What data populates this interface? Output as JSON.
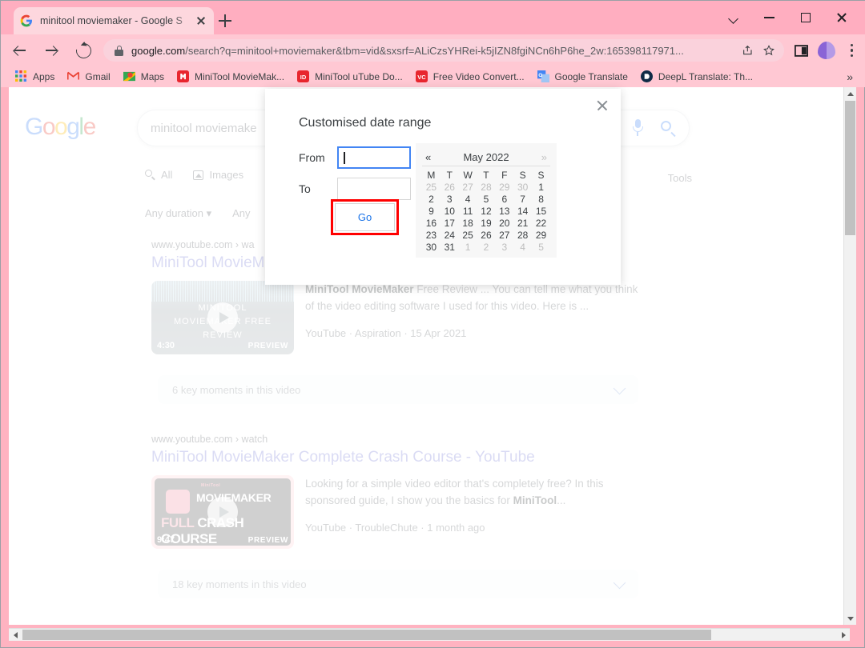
{
  "browser": {
    "tab": {
      "title": "minitool moviemaker - Google S",
      "favicon": "google-favicon"
    },
    "new_tab_label": "+",
    "window_controls": {
      "tab_search": "tab-search",
      "minimize": "minimize",
      "maximize": "maximize",
      "close": "close"
    },
    "nav": {
      "back": "back",
      "forward": "forward",
      "reload": "reload"
    },
    "omnibox": {
      "lock": "lock-icon",
      "url_domain": "google.com",
      "url_path": "/search?q=minitool+moviemaker&tbm=vid&sxsrf=ALiCzsYHRei-k5jIZN8fgiNCn6hP6he_2w:165398117971...",
      "share": "share-icon",
      "bookmark_star": "star-icon"
    },
    "toolbar_right": {
      "side_panel": "side-panel-icon",
      "avatar": "avatar",
      "menu": "kebab-menu-icon"
    },
    "bookmarks": [
      {
        "label": "Apps",
        "icon": "apps-grid-icon"
      },
      {
        "label": "Gmail",
        "icon": "gmail-icon"
      },
      {
        "label": "Maps",
        "icon": "maps-icon"
      },
      {
        "label": "MiniTool MovieMak...",
        "icon": "minitool-moviemaker-icon"
      },
      {
        "label": "MiniTool uTube Do...",
        "icon": "minitool-utube-icon"
      },
      {
        "label": "Free Video Convert...",
        "icon": "free-video-converter-icon"
      },
      {
        "label": "Google Translate",
        "icon": "google-translate-icon"
      },
      {
        "label": "DeepL Translate: Th...",
        "icon": "deepl-icon"
      }
    ],
    "bookmarks_overflow": "»"
  },
  "google": {
    "logo_letters": [
      "G",
      "o",
      "o",
      "g",
      "l",
      "e"
    ],
    "search_query": "minitool moviemake",
    "mic_icon": "microphone-icon",
    "search_icon": "search-icon",
    "tabs": [
      {
        "label": "All",
        "icon": "search-icon"
      },
      {
        "label": "Images",
        "icon": "image-icon"
      }
    ],
    "tools_label": "Tools",
    "filters": [
      {
        "label": "Any duration ▾"
      },
      {
        "label": "Any"
      }
    ],
    "results": [
      {
        "url": "www.youtube.com › wa",
        "title": "MiniTool MovieM",
        "thumb_lines": [
          "MINITOOL",
          "MOVIEMAKER FREE",
          "REVIEW"
        ],
        "duration": "4:30",
        "preview_badge": "PREVIEW",
        "snippet_bold": "MiniTool MovieMaker",
        "snippet_rest": " Free Review ... You can tell me what you think of the video editing software I used for this video. Here is ...",
        "meta": "YouTube · Aspiration · 15 Apr 2021",
        "key_moments": "6 key moments in this video"
      },
      {
        "url": "www.youtube.com › watch",
        "title": "MiniTool MovieMaker Complete Crash Course - YouTube",
        "thumb_brand": "MOVIEMAKER",
        "thumb_mini": "MiniTool",
        "thumb_line2_em": "FULL",
        "thumb_line2_rest": " CRASH COURSE",
        "duration": "9:47",
        "preview_badge": "PREVIEW",
        "snippet_plain": "Looking for a simple video editor that's completely free? In this sponsored guide, I show you the basics for ",
        "snippet_bold": "MiniTool",
        "snippet_tail": "...",
        "meta": "YouTube · TroubleChute · 1 month ago",
        "key_moments": "18 key moments in this video"
      }
    ]
  },
  "modal": {
    "title": "Customised date range",
    "close_icon": "close-icon",
    "from_label": "From",
    "from_value": "",
    "to_label": "To",
    "to_value": "",
    "go_label": "Go",
    "highlight_color": "#ff0000",
    "calendar": {
      "prev": "«",
      "next": "»",
      "month": "May 2022",
      "weekdays": [
        "M",
        "T",
        "W",
        "T",
        "F",
        "S",
        "S"
      ],
      "weeks": [
        [
          {
            "d": "25",
            "out": true
          },
          {
            "d": "26",
            "out": true
          },
          {
            "d": "27",
            "out": true
          },
          {
            "d": "28",
            "out": true
          },
          {
            "d": "29",
            "out": true
          },
          {
            "d": "30",
            "out": true
          },
          {
            "d": "1",
            "out": false
          }
        ],
        [
          {
            "d": "2",
            "out": false
          },
          {
            "d": "3",
            "out": false
          },
          {
            "d": "4",
            "out": false
          },
          {
            "d": "5",
            "out": false
          },
          {
            "d": "6",
            "out": false
          },
          {
            "d": "7",
            "out": false
          },
          {
            "d": "8",
            "out": false
          }
        ],
        [
          {
            "d": "9",
            "out": false
          },
          {
            "d": "10",
            "out": false
          },
          {
            "d": "11",
            "out": false
          },
          {
            "d": "12",
            "out": false
          },
          {
            "d": "13",
            "out": false
          },
          {
            "d": "14",
            "out": false
          },
          {
            "d": "15",
            "out": false
          }
        ],
        [
          {
            "d": "16",
            "out": false
          },
          {
            "d": "17",
            "out": false
          },
          {
            "d": "18",
            "out": false
          },
          {
            "d": "19",
            "out": false
          },
          {
            "d": "20",
            "out": false
          },
          {
            "d": "21",
            "out": false
          },
          {
            "d": "22",
            "out": false
          }
        ],
        [
          {
            "d": "23",
            "out": false
          },
          {
            "d": "24",
            "out": false
          },
          {
            "d": "25",
            "out": false
          },
          {
            "d": "26",
            "out": false
          },
          {
            "d": "27",
            "out": false
          },
          {
            "d": "28",
            "out": false
          },
          {
            "d": "29",
            "out": false
          }
        ],
        [
          {
            "d": "30",
            "out": false
          },
          {
            "d": "31",
            "out": false
          },
          {
            "d": "1",
            "out": true
          },
          {
            "d": "2",
            "out": true
          },
          {
            "d": "3",
            "out": true
          },
          {
            "d": "4",
            "out": true
          },
          {
            "d": "5",
            "out": true
          }
        ]
      ]
    }
  },
  "scrollbars": {
    "vertical": "vertical-scrollbar",
    "horizontal": "horizontal-scrollbar"
  }
}
